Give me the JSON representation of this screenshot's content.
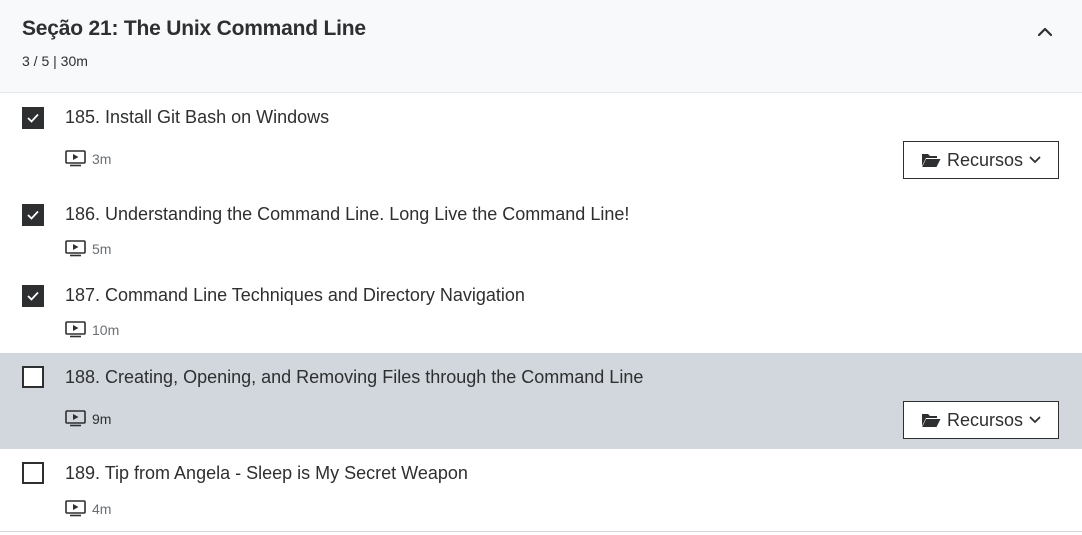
{
  "section": {
    "title": "Seção 21: The Unix Command Line",
    "meta": "3 / 5 | 30m"
  },
  "lectures": [
    {
      "title": "185. Install Git Bash on Windows",
      "duration": "3m",
      "checked": true,
      "resources_label": "Recursos"
    },
    {
      "title": "186. Understanding the Command Line. Long Live the Command Line!",
      "duration": "5m",
      "checked": true
    },
    {
      "title": "187. Command Line Techniques and Directory Navigation",
      "duration": "10m",
      "checked": true
    },
    {
      "title": "188. Creating, Opening, and Removing Files through the Command Line",
      "duration": "9m",
      "checked": false,
      "active": true,
      "resources_label": "Recursos"
    },
    {
      "title": "189. Tip from Angela - Sleep is My Secret Weapon",
      "duration": "4m",
      "checked": false
    }
  ],
  "colors": {
    "active_row": "#d1d7dc",
    "header_bg": "#f7f9fa",
    "text": "#2d2f31",
    "muted": "#6a6f73"
  },
  "icons": {
    "collapse": "chevron-up-icon",
    "video": "video-icon",
    "folder": "folder-open-icon",
    "dropdown": "chevron-down-icon",
    "check": "check-icon"
  }
}
